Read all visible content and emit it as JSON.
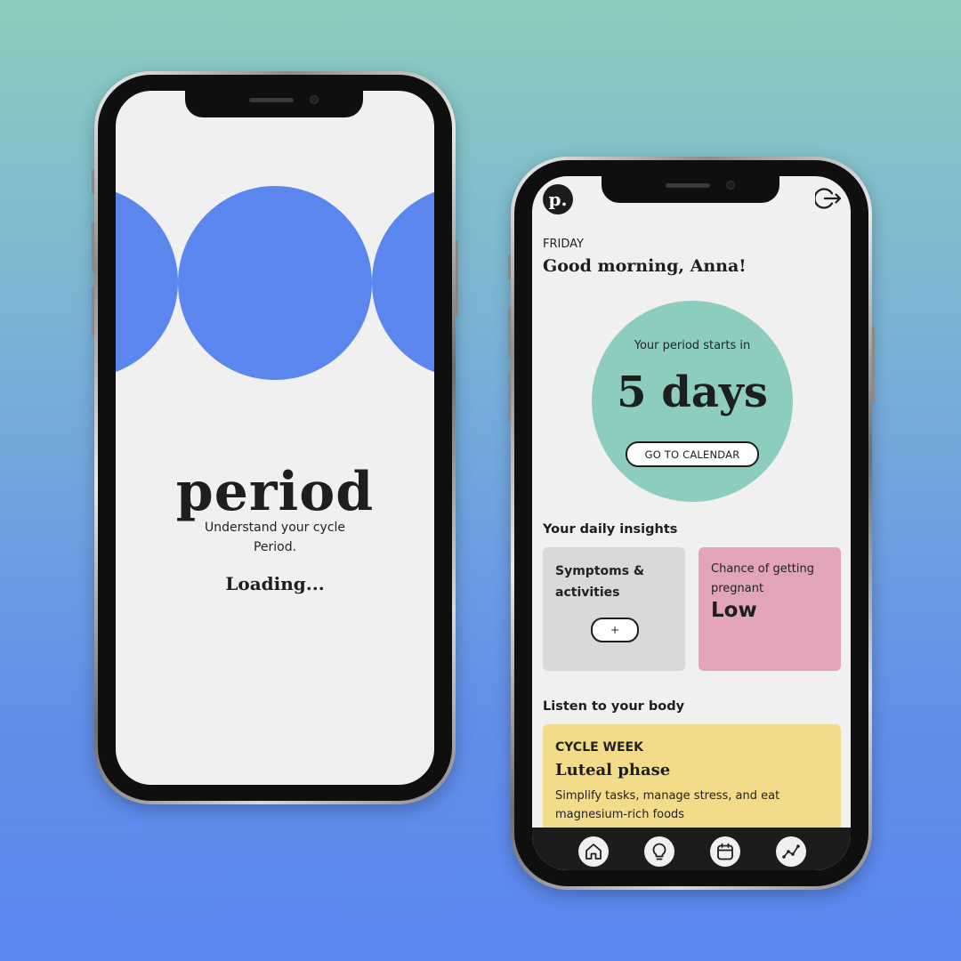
{
  "splash": {
    "brand": "period",
    "tagline_line1": "Understand your cycle",
    "tagline_line2": "Period.",
    "loading": "Loading..."
  },
  "home": {
    "logo_letter": "p.",
    "logout_icon": "logout-icon",
    "day": "FRIDAY",
    "greeting": "Good morning, Anna!",
    "countdown": {
      "label": "Your period starts in",
      "value": "5 days",
      "button": "GO TO CALENDAR"
    },
    "insights": {
      "heading": "Your daily insights",
      "symptoms": {
        "title_line1": "Symptoms &",
        "title_line2": "activities",
        "button": "+"
      },
      "pregnancy": {
        "label": "Chance of getting pregnant",
        "value": "Low"
      }
    },
    "body": {
      "heading": "Listen to your body",
      "eyebrow": "CYCLE WEEK",
      "phase": "Luteal phase",
      "advice": "Simplify tasks, manage stress, and eat magnesium-rich foods"
    },
    "tabs": [
      {
        "name": "home",
        "icon": "home-icon"
      },
      {
        "name": "insights",
        "icon": "lightbulb-icon"
      },
      {
        "name": "calendar",
        "icon": "calendar-icon"
      },
      {
        "name": "stats",
        "icon": "chart-icon"
      }
    ]
  },
  "colors": {
    "accent_blue": "#5a86ee",
    "mint": "#8ccdbf",
    "pink": "#e1a4ba",
    "yellow": "#f2dc8a",
    "card_grey": "#d9d9d9",
    "screen_bg": "#f0f0f0",
    "dark": "#1e1e1e"
  }
}
